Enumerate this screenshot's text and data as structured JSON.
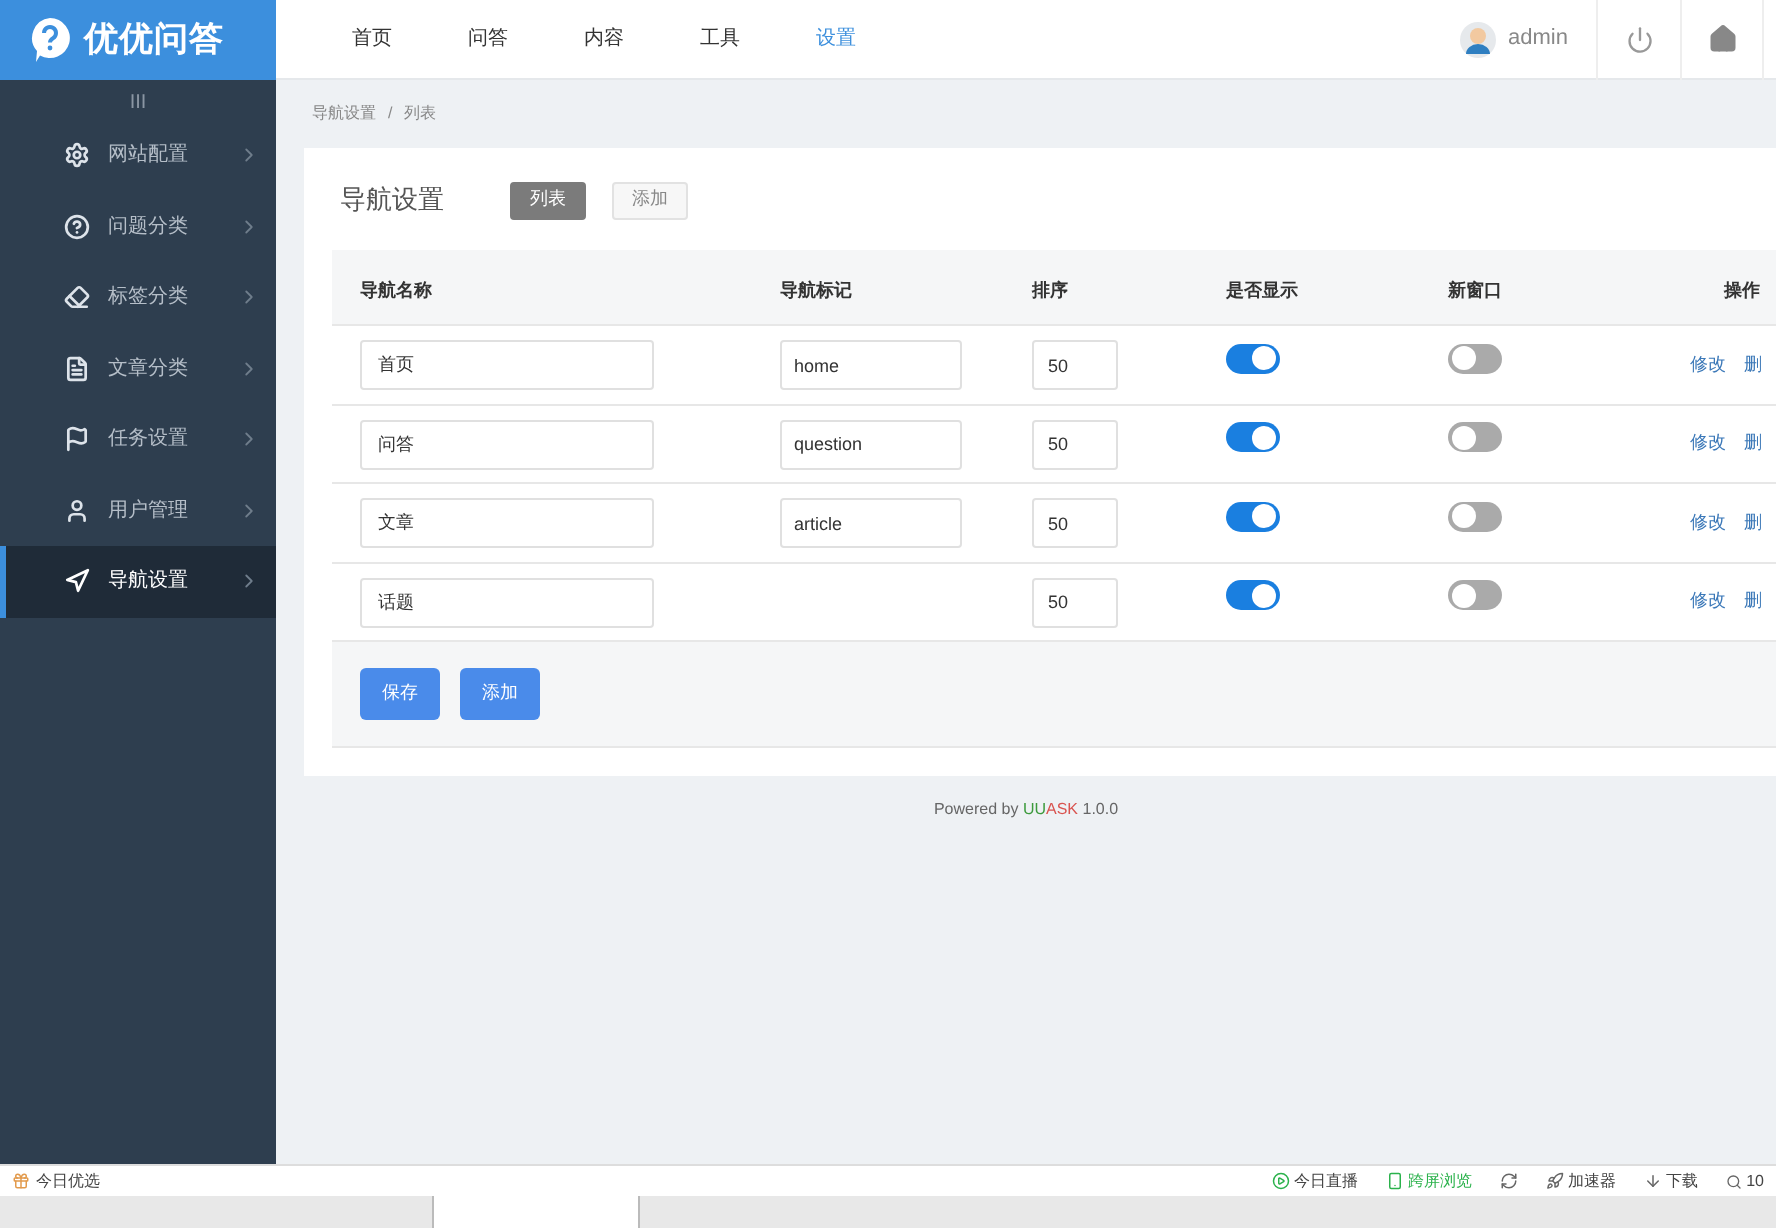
{
  "logo": {
    "text": "优优问答"
  },
  "top_nav": [
    {
      "label": "首页",
      "selected": false
    },
    {
      "label": "问答",
      "selected": false
    },
    {
      "label": "内容",
      "selected": false
    },
    {
      "label": "工具",
      "selected": false
    },
    {
      "label": "设置",
      "selected": true
    }
  ],
  "user": {
    "name": "admin"
  },
  "sidebar": {
    "collapse": "III",
    "items": [
      {
        "label": "网站配置",
        "selected": false
      },
      {
        "label": "问题分类",
        "selected": false
      },
      {
        "label": "标签分类",
        "selected": false
      },
      {
        "label": "文章分类",
        "selected": false
      },
      {
        "label": "任务设置",
        "selected": false
      },
      {
        "label": "用户管理",
        "selected": false
      },
      {
        "label": "导航设置",
        "selected": true
      }
    ]
  },
  "breadcrumb": [
    "导航设置",
    "/",
    "列表"
  ],
  "panel": {
    "title": "导航设置",
    "tabs": [
      {
        "label": "列表",
        "selected": true
      },
      {
        "label": "添加",
        "selected": false
      }
    ]
  },
  "table": {
    "columns": [
      "导航名称",
      "导航标记",
      "排序",
      "是否显示",
      "新窗口",
      "操作"
    ],
    "rows": [
      {
        "name": "首页",
        "mark": "home",
        "sort": "50",
        "show": true,
        "new_window": false,
        "actions": [
          "修改",
          "删"
        ]
      },
      {
        "name": "问答",
        "mark": "question",
        "sort": "50",
        "show": true,
        "new_window": false,
        "actions": [
          "修改",
          "删"
        ]
      },
      {
        "name": "文章",
        "mark": "article",
        "sort": "50",
        "show": true,
        "new_window": false,
        "actions": [
          "修改",
          "删"
        ]
      },
      {
        "name": "话题",
        "sort": "50",
        "show": true,
        "new_window": false,
        "actions": [
          "修改",
          "删"
        ]
      }
    ]
  },
  "buttons": [
    "保存",
    "添加"
  ],
  "footer": {
    "prefix": "Powered by",
    "brand": [
      "UU",
      "ASK"
    ],
    "version": "1.0.0"
  },
  "status_bar": {
    "left": "今日优选",
    "items": [
      {
        "kind": "link",
        "label": "今日直播"
      },
      {
        "kind": "link",
        "label": "跨屏浏览"
      },
      {
        "kind": "icon"
      },
      {
        "kind": "link",
        "label": "加速器"
      },
      {
        "kind": "link",
        "label": "下载"
      }
    ],
    "zoom": "10"
  }
}
